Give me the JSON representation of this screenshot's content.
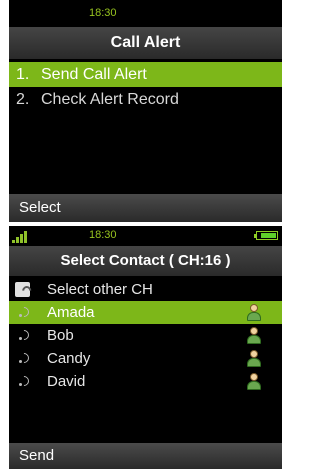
{
  "screen1": {
    "status_time": "18:30",
    "title": "Call Alert",
    "menu": [
      {
        "num": "1.",
        "label": "Send Call Alert",
        "selected": true
      },
      {
        "num": "2.",
        "label": "Check Alert Record",
        "selected": false
      }
    ],
    "softkey_left": "Select"
  },
  "screen2": {
    "status_time": "18:30",
    "title": "Select Contact ( CH:16 )",
    "select_other_label": "Select other CH",
    "contacts": [
      {
        "name": "Amada",
        "selected": true
      },
      {
        "name": "Bob",
        "selected": false
      },
      {
        "name": "Candy",
        "selected": false
      },
      {
        "name": "David",
        "selected": false
      }
    ],
    "softkey_left": "Send"
  },
  "colors": {
    "highlight": "#7db719",
    "status_text": "#97c31f",
    "background": "#000000"
  }
}
